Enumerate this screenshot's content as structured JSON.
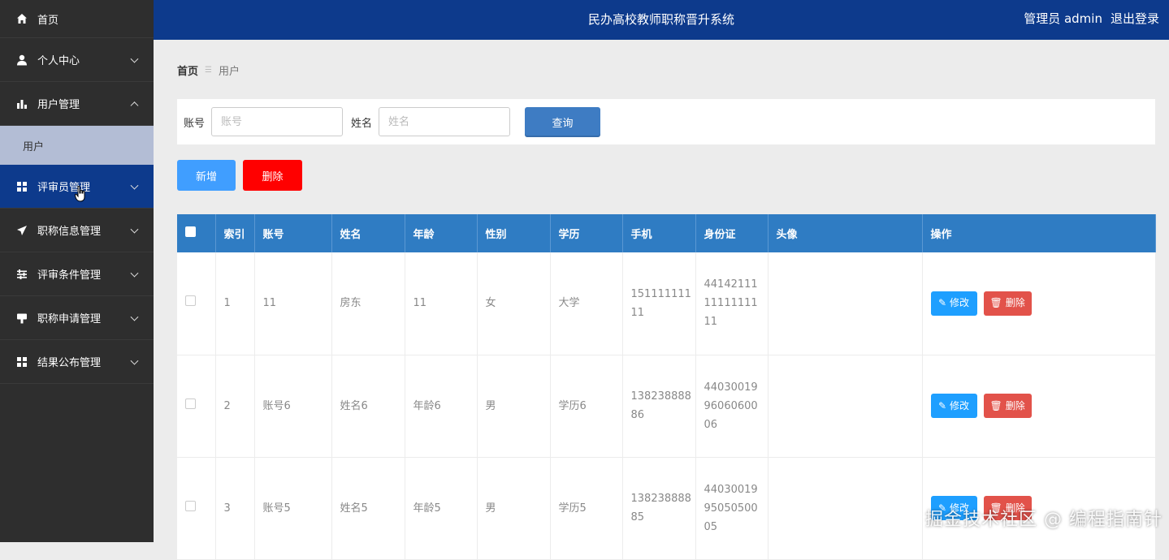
{
  "header": {
    "title": "民办高校教师职称晋升系统",
    "user": "管理员 admin",
    "logout": "退出登录"
  },
  "sidebar": {
    "items": [
      {
        "label": "首页",
        "icon": "home-icon"
      },
      {
        "label": "个人中心",
        "icon": "user-icon"
      },
      {
        "label": "用户管理",
        "icon": "bar-chart-icon"
      },
      {
        "label": "评审员管理",
        "icon": "grid-icon"
      },
      {
        "label": "职称信息管理",
        "icon": "send-icon"
      },
      {
        "label": "评审条件管理",
        "icon": "sliders-icon"
      },
      {
        "label": "职称申请管理",
        "icon": "sign-icon"
      },
      {
        "label": "结果公布管理",
        "icon": "grid-icon"
      }
    ],
    "submenu": {
      "label": "用户"
    }
  },
  "breadcrumb": {
    "home": "首页",
    "current": "用户"
  },
  "search": {
    "account_label": "账号",
    "account_placeholder": "账号",
    "name_label": "姓名",
    "name_placeholder": "姓名",
    "query_label": "查询"
  },
  "actions": {
    "add_label": "新增",
    "delete_label": "删除"
  },
  "table": {
    "headers": [
      "索引",
      "账号",
      "姓名",
      "年龄",
      "性别",
      "学历",
      "手机",
      "身份证",
      "头像",
      "操作"
    ],
    "edit_label": "修改",
    "delete_label": "删除",
    "rows": [
      {
        "index": "1",
        "account": "11",
        "name": "房东",
        "age": "11",
        "gender": "女",
        "education": "大学",
        "phone": "15111111111",
        "idcard": "441421111111111111"
      },
      {
        "index": "2",
        "account": "账号6",
        "name": "姓名6",
        "age": "年龄6",
        "gender": "男",
        "education": "学历6",
        "phone": "13823888886",
        "idcard": "440300199606060006"
      },
      {
        "index": "3",
        "account": "账号5",
        "name": "姓名5",
        "age": "年龄5",
        "gender": "男",
        "education": "学历5",
        "phone": "13823888885",
        "idcard": "440300199505050005"
      }
    ]
  },
  "watermark": "掘金技术社区 @ 编程指南针",
  "colors": {
    "header": "#0d3a8c",
    "sidebar": "#2e2e2e",
    "table_header": "#2f7cc3",
    "add": "#409eff",
    "delete": "#ff0000",
    "edit": "#1e9fff",
    "row_delete": "#e2524a"
  }
}
